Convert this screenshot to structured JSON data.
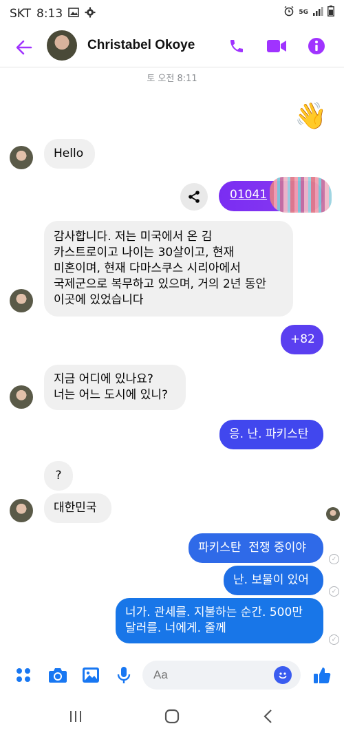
{
  "status_bar": {
    "carrier": "SKT",
    "time": "8:13",
    "network": "5G"
  },
  "header": {
    "contact_name": "Christabel Okoye"
  },
  "icons": {
    "back": "arrow-left-icon",
    "call": "phone-icon",
    "video": "video-camera-icon",
    "info": "info-icon",
    "share": "share-icon",
    "menu": "four-dots-icon",
    "camera": "camera-icon",
    "gallery": "image-icon",
    "mic": "microphone-icon",
    "emoji": "smiley-icon",
    "like": "thumbs-up-icon"
  },
  "colors": {
    "accent": "#a033ff",
    "outgoing": "#3a5cf0",
    "incoming": "#f0f0f0",
    "link_bubble": "#7a2df2"
  },
  "conversation": {
    "timestamp": "토 오전 8:11",
    "wave_emoji": "👋",
    "msg_hello": "Hello",
    "msg_link": "01041",
    "msg_intro": [
      "감사합니다. 저는 미국에서 온 김",
      "카스트로이고 나이는 30살이고, 현재",
      "미혼이며, 현재 다마스쿠스 시리아에서",
      "국제군으로 복무하고 있으며, 거의 2년 동안",
      "이곳에 있었습니다"
    ],
    "msg_plus82": "+82",
    "msg_where": [
      "지금 어디에 있나요?",
      "너는 어느 도시에 있니?"
    ],
    "msg_pakistan": "응. 난. 파키스탄",
    "msg_question": "?",
    "msg_korea": "대한민국",
    "msg_war": "파키스탄  전쟁 중이야",
    "msg_treasure": "난. 보물이 있어",
    "msg_money": [
      "너가. 관세를. 지불하는 순간. 500만",
      "달러를. 너에게. 줄께"
    ]
  },
  "composer": {
    "placeholder": "Aa"
  },
  "navbar": {
    "recent": "|||",
    "home": "○",
    "back": "<"
  }
}
